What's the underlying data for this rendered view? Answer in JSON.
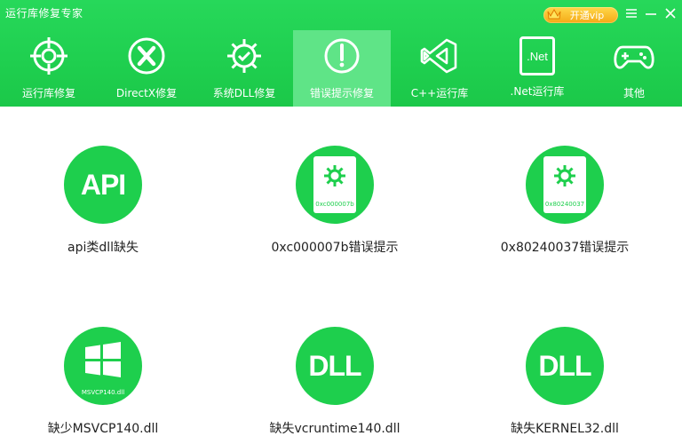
{
  "app": {
    "title": "运行库修复专家",
    "vip_button": "开通vip",
    "controls": {
      "menu": "menu-icon",
      "minimize": "minimize-icon",
      "close": "close-icon"
    }
  },
  "nav": {
    "tabs": [
      {
        "label": "运行库修复",
        "icon": "crosshair-icon"
      },
      {
        "label": "DirectX修复",
        "icon": "directx-icon"
      },
      {
        "label": "系统DLL修复",
        "icon": "gear-icon"
      },
      {
        "label": "错误提示修复",
        "icon": "warning-icon",
        "active": true
      },
      {
        "label": "C++运行库",
        "icon": "visual-studio-icon"
      },
      {
        "label": ".Net运行库",
        "icon": "dotnet-icon",
        "icon_text": ".Net"
      },
      {
        "label": "其他",
        "icon": "gamepad-icon"
      }
    ]
  },
  "tiles": [
    {
      "label": "api类dll缺失",
      "icon": "api-icon",
      "icon_text": "API"
    },
    {
      "label": "0xc000007b错误提示",
      "icon": "error-doc-icon",
      "icon_text": "0xc000007b"
    },
    {
      "label": "0x80240037错误提示",
      "icon": "error-doc-icon",
      "icon_text": "0x80240037"
    },
    {
      "label": "缺少MSVCP140.dll",
      "icon": "windows-icon",
      "icon_text": "MSVCP140.dll"
    },
    {
      "label": "缺失vcruntime140.dll",
      "icon": "dll-icon",
      "icon_text": "DLL"
    },
    {
      "label": "缺失KERNEL32.dll",
      "icon": "dll-icon",
      "icon_text": "DLL"
    }
  ],
  "colors": {
    "brand_green": "#1ecf4d",
    "header_green": "#22d455",
    "active_tab": "#5fe487",
    "vip_gold": "#f4a916"
  }
}
